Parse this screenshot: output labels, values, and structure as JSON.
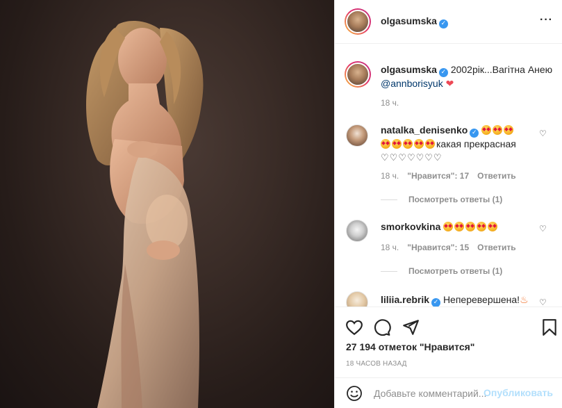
{
  "post": {
    "author": "olgasumska",
    "caption_text": "2002рік...Вагітна Анею",
    "caption_mention": "@annborisyuk",
    "caption_time": "18 ч.",
    "verified_glyph": "✓"
  },
  "comments": [
    {
      "user": "natalka_denisenko",
      "line2_text": "какая прекрасная",
      "hearts": "♡♡♡♡♡♡♡",
      "time": "18 ч.",
      "likes": "\"Нравится\": 17",
      "reply": "Ответить",
      "view_replies": "Посмотреть ответы (1)"
    },
    {
      "user": "smorkovkina",
      "time": "18 ч.",
      "likes": "\"Нравится\": 15",
      "reply": "Ответить",
      "view_replies": "Посмотреть ответы (1)"
    },
    {
      "user": "liliia.rebrik",
      "text": "Неперевершена!"
    }
  ],
  "stats": {
    "likes_count": "27 194 отметок \"Нравится\"",
    "time_ago": "18 ЧАСОВ НАЗАД"
  },
  "add_comment": {
    "placeholder": "Добавьте комментарий...",
    "publish_label": "Опубликовать"
  },
  "icons": [
    "heart-icon",
    "comment-icon",
    "share-icon",
    "bookmark-icon",
    "emoji-icon",
    "verified-icon"
  ],
  "colors": {
    "verified": "#3897f0",
    "mention": "#00376b",
    "muted": "#8e8e8e",
    "publish_disabled": "#b2dffc",
    "heart": "#ed4956"
  }
}
